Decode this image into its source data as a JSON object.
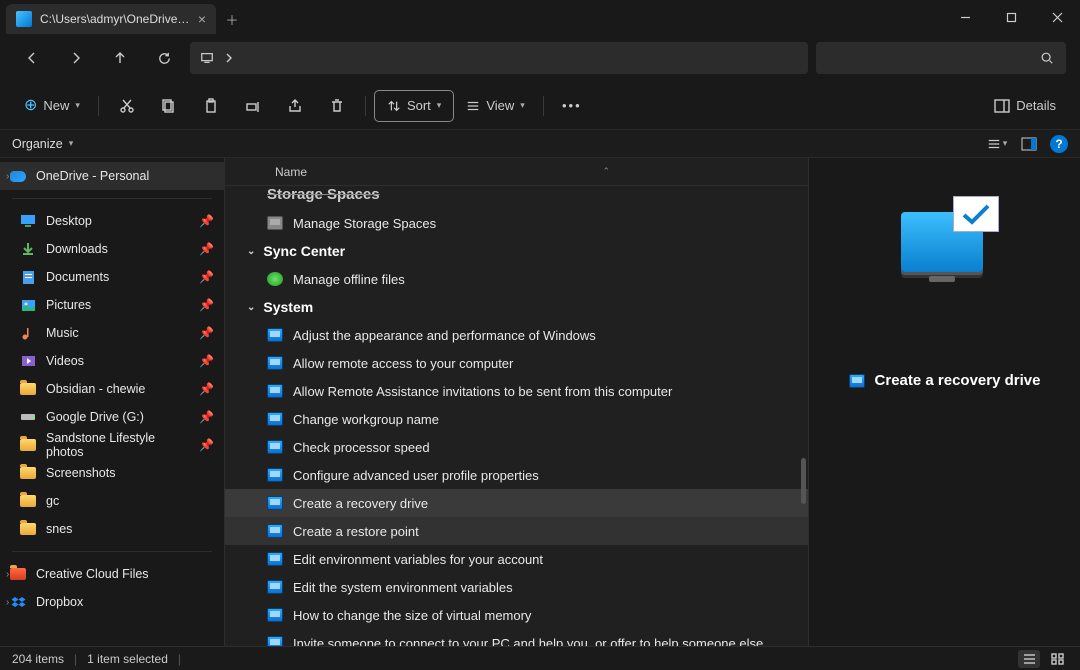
{
  "titlebar": {
    "tab_title": "C:\\Users\\admyr\\OneDrive\\Des"
  },
  "toolbar": {
    "new_label": "New",
    "sort_label": "Sort",
    "view_label": "View",
    "details_label": "Details"
  },
  "orgbar": {
    "organize_label": "Organize"
  },
  "sidebar": {
    "onedrive": "OneDrive - Personal",
    "desktop": "Desktop",
    "downloads": "Downloads",
    "documents": "Documents",
    "pictures": "Pictures",
    "music": "Music",
    "videos": "Videos",
    "obsidian": "Obsidian - chewie",
    "gdrive": "Google Drive (G:)",
    "sandstone": "Sandstone Lifestyle photos",
    "screenshots": "Screenshots",
    "gc": "gc",
    "snes": "snes",
    "ccf": "Creative Cloud Files",
    "dropbox": "Dropbox"
  },
  "list": {
    "header_name": "Name",
    "group_storage_cut": "Storage Spaces",
    "storage_items": [
      "Manage Storage Spaces"
    ],
    "group_sync": "Sync Center",
    "sync_items": [
      "Manage offline files"
    ],
    "group_system": "System",
    "system_items": [
      "Adjust the appearance and performance of Windows",
      "Allow remote access to your computer",
      "Allow Remote Assistance invitations to be sent from this computer",
      "Change workgroup name",
      "Check processor speed",
      "Configure advanced user profile properties",
      "Create a recovery drive",
      "Create a restore point",
      "Edit environment variables for your account",
      "Edit the system environment variables",
      "How to change the size of virtual memory",
      "Invite someone to connect to your PC and help you, or offer to help someone else"
    ]
  },
  "preview": {
    "title": "Create a recovery drive"
  },
  "status": {
    "count": "204 items",
    "selection": "1 item selected"
  }
}
